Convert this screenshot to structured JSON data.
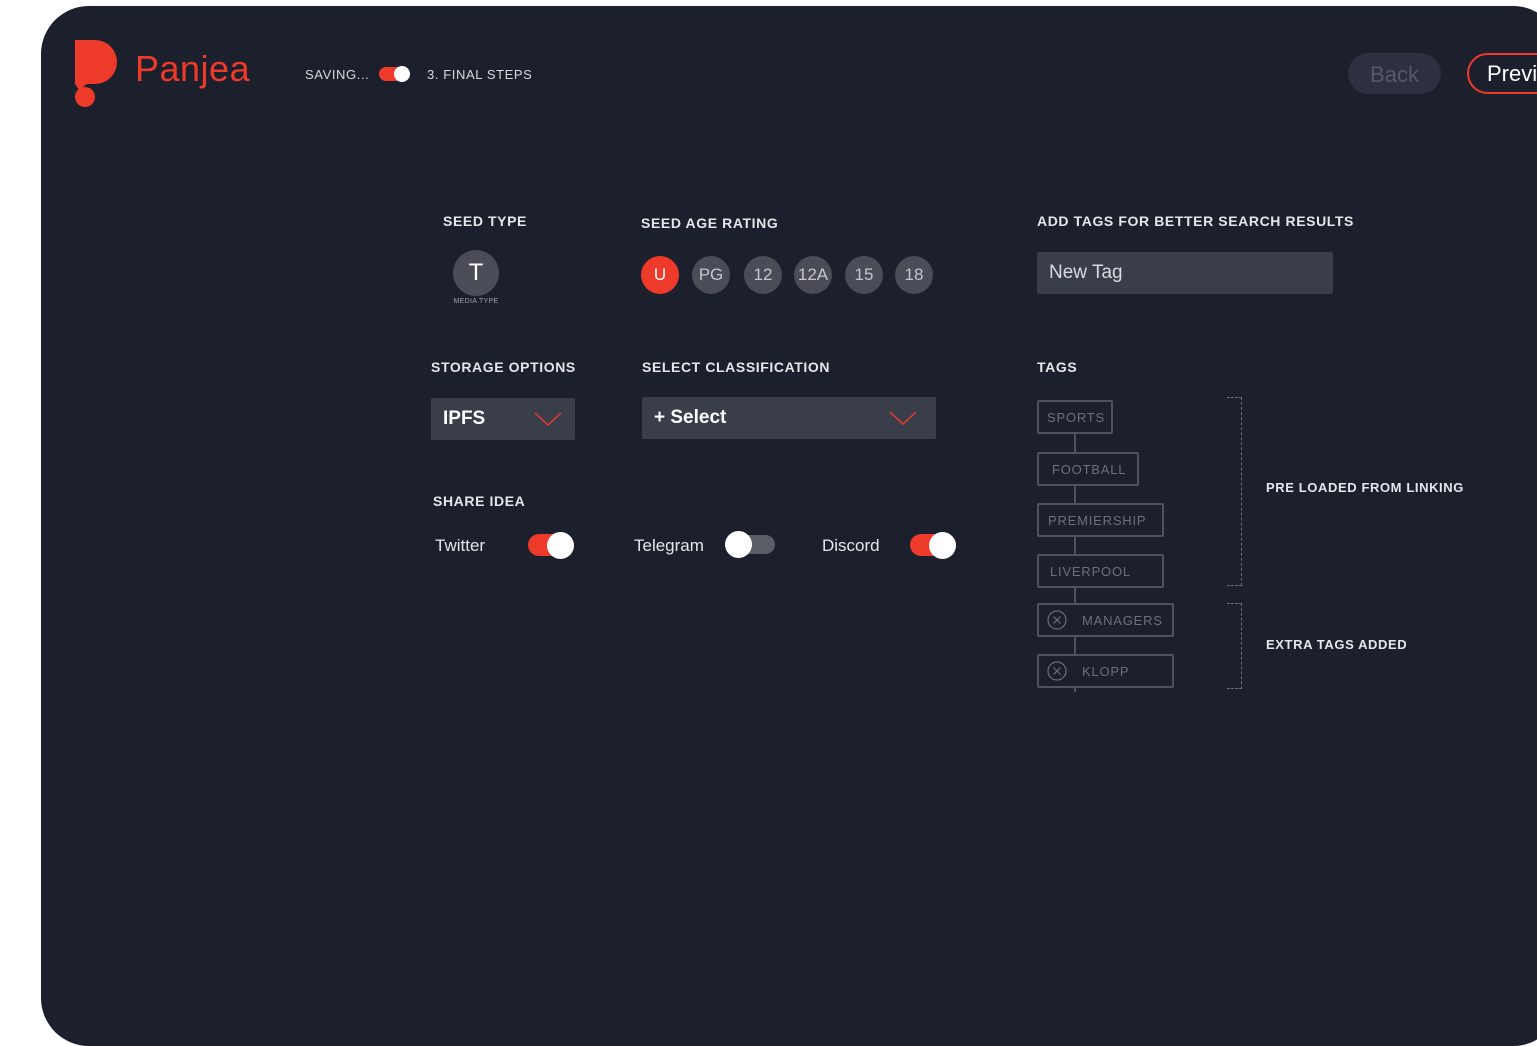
{
  "brand": {
    "name": "Panjea",
    "color": "#ee3a2a"
  },
  "header": {
    "saving_label": "SAVING...",
    "saving_toggle_on": true,
    "step_label": "3. FINAL STEPS",
    "back_label": "Back",
    "preview_label": "Previ"
  },
  "seed_type": {
    "label": "SEED TYPE",
    "value": "T",
    "caption": "MEDIA TYPE"
  },
  "age_rating": {
    "label": "SEED AGE RATING",
    "options": [
      "U",
      "PG",
      "12",
      "12A",
      "15",
      "18"
    ],
    "selected": "U"
  },
  "add_tags": {
    "label": "ADD TAGS FOR BETTER SEARCH RESULTS",
    "placeholder": "New Tag"
  },
  "storage": {
    "label": "STORAGE OPTIONS",
    "value": "IPFS"
  },
  "classification": {
    "label": "SELECT CLASSIFICATION",
    "value": "+ Select"
  },
  "share": {
    "label": "SHARE IDEA",
    "twitter": {
      "label": "Twitter",
      "on": true
    },
    "telegram": {
      "label": "Telegram",
      "on": false
    },
    "discord": {
      "label": "Discord",
      "on": true
    }
  },
  "tags": {
    "label": "TAGS",
    "preloaded": [
      "SPORTS",
      "FOOTBALL",
      "PREMIERSHIP",
      "LIVERPOOL"
    ],
    "extra": [
      "MANAGERS",
      "KLOPP"
    ],
    "preloaded_note": "PRE LOADED FROM LINKING",
    "extra_note": "EXTRA TAGS ADDED"
  },
  "colors": {
    "background": "#1c1f2c",
    "accent": "#ee3a2a",
    "toggle_off": "#5a5d66"
  }
}
